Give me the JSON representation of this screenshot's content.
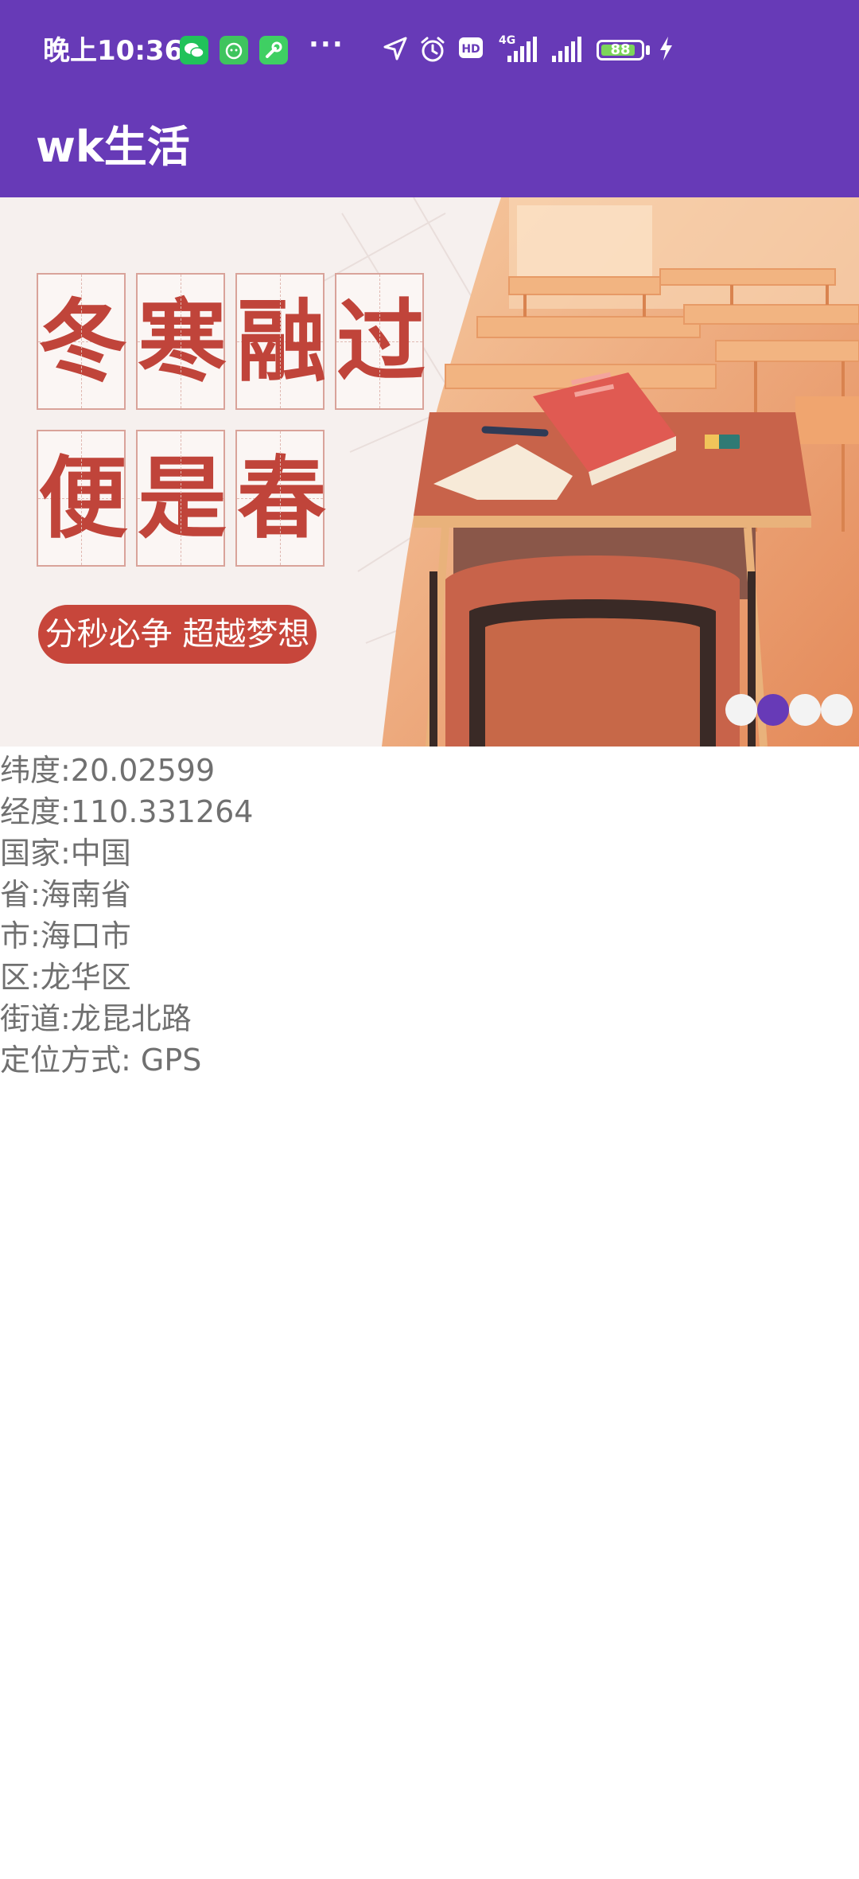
{
  "status_bar": {
    "time": "晚上10:36",
    "more": "···",
    "network": "4G",
    "battery": "88",
    "battery_level": 0.88,
    "icons": [
      "wechat-icon",
      "pet-app-icon",
      "wrench-app-icon",
      "location-arrow-icon",
      "alarm-icon",
      "hd-icon",
      "signal-icon",
      "signal-icon",
      "charging-icon"
    ]
  },
  "toolbar": {
    "title": "wk生活"
  },
  "banner": {
    "line1": [
      "冬",
      "寒",
      "融",
      "过"
    ],
    "line2": [
      "便",
      "是",
      "春"
    ],
    "slogan": "分秒必争 超越梦想",
    "dots_total": 4,
    "active_dot": 2
  },
  "location": {
    "latitude": "纬度:20.02599",
    "longitude": "经度:110.331264",
    "country": "国家:中国",
    "province": "省:海南省",
    "city": "市:海口市",
    "district": "区:龙华区",
    "street": "街道:龙昆北路",
    "method": "定位方式: GPS"
  },
  "colors": {
    "primary": "#673ab7",
    "banner_red": "#c0443a",
    "text_gray": "#707070"
  }
}
